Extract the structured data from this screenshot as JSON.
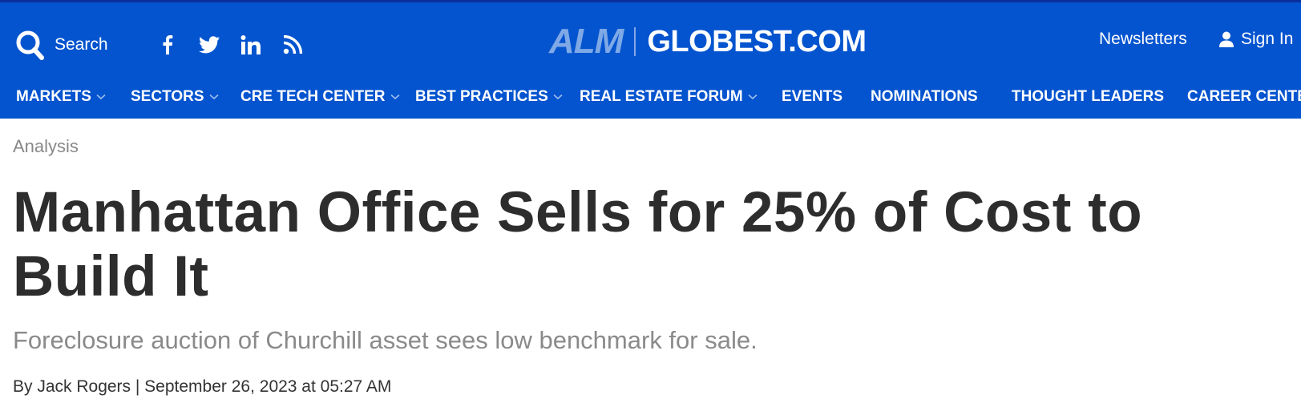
{
  "header": {
    "search_label": "Search",
    "social_icons": [
      "facebook-icon",
      "twitter-icon",
      "linkedin-icon",
      "rss-icon"
    ],
    "logo_alm": "ALM",
    "logo_globest": "GLOBEST.COM",
    "newsletters_label": "Newsletters",
    "signin_label": "Sign In",
    "colors": {
      "bar": "#0454cf",
      "top_line": "#0a2f9c",
      "alm": "#7fa9e6"
    }
  },
  "nav": {
    "items": [
      {
        "label": "MARKETS",
        "has_dropdown": true
      },
      {
        "label": "SECTORS",
        "has_dropdown": true
      },
      {
        "label": "CRE TECH CENTER",
        "has_dropdown": true
      },
      {
        "label": "BEST PRACTICES",
        "has_dropdown": true
      },
      {
        "label": "REAL ESTATE FORUM",
        "has_dropdown": true
      },
      {
        "label": "EVENTS",
        "has_dropdown": false
      },
      {
        "label": "NOMINATIONS",
        "has_dropdown": false
      },
      {
        "label": "THOUGHT LEADERS",
        "has_dropdown": false
      },
      {
        "label": "CAREER CENTER",
        "has_dropdown": false
      }
    ]
  },
  "article": {
    "kicker": "Analysis",
    "headline": "Manhattan Office Sells for 25% of Cost to Build It",
    "subtitle": "Foreclosure auction of Churchill asset sees low benchmark for sale.",
    "byline": "By Jack Rogers | September 26, 2023 at 05:27 AM"
  }
}
